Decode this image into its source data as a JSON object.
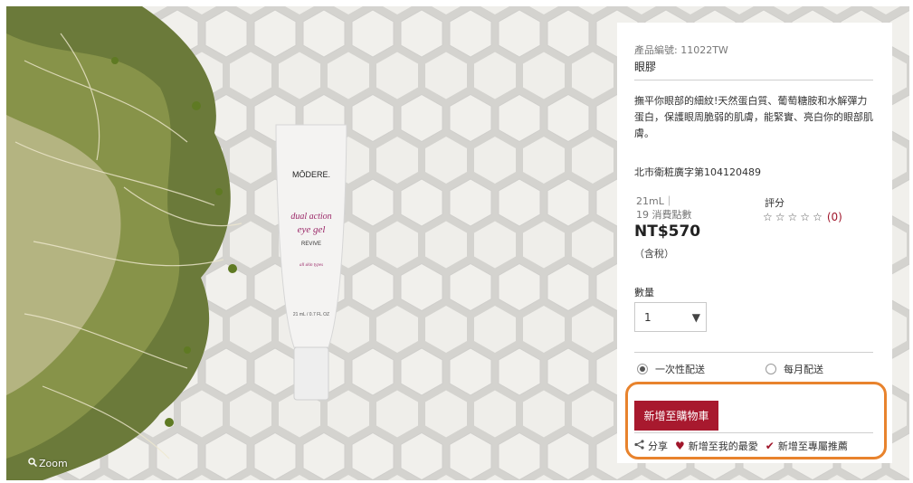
{
  "image": {
    "zoom_label": "Zoom"
  },
  "product": {
    "tube_brand": "MŌDERE.",
    "tube_name_line1": "dual action",
    "tube_name_line2": "eye gel",
    "tube_sub": "REVIVE",
    "tube_skin": "all skin types",
    "tube_size": "21 mL / 0.7 FL OZ",
    "code_label": "產品編號:",
    "code": "11022TW",
    "name": "眼膠",
    "description": "撫平你眼部的細紋!天然蛋白質、葡萄糖胺和水解彈力蛋白，保護眼周脆弱的肌膚，能緊實、亮白你的眼部肌膚。",
    "license": "北市衛粧廣字第104120489",
    "volume": "21mL｜",
    "points": "19 消費點數",
    "price": "NT$570",
    "tax_note": "（含稅）",
    "rating_label": "評分",
    "stars": [
      "☆",
      "☆",
      "☆",
      "☆",
      "☆"
    ],
    "rating_count": "(0)",
    "qty_label": "數量",
    "qty_value": "1",
    "delivery": {
      "one_time": "一次性配送",
      "monthly": "每月配送",
      "selected": "one_time"
    },
    "add_to_cart": "新增至購物車",
    "actions": {
      "share": "分享",
      "favorite": "新增至我的最愛",
      "recommend": "新增至專屬推薦"
    }
  },
  "colors": {
    "accent": "#a8192e",
    "highlight": "#e8832d",
    "rating": "#a0162b"
  }
}
